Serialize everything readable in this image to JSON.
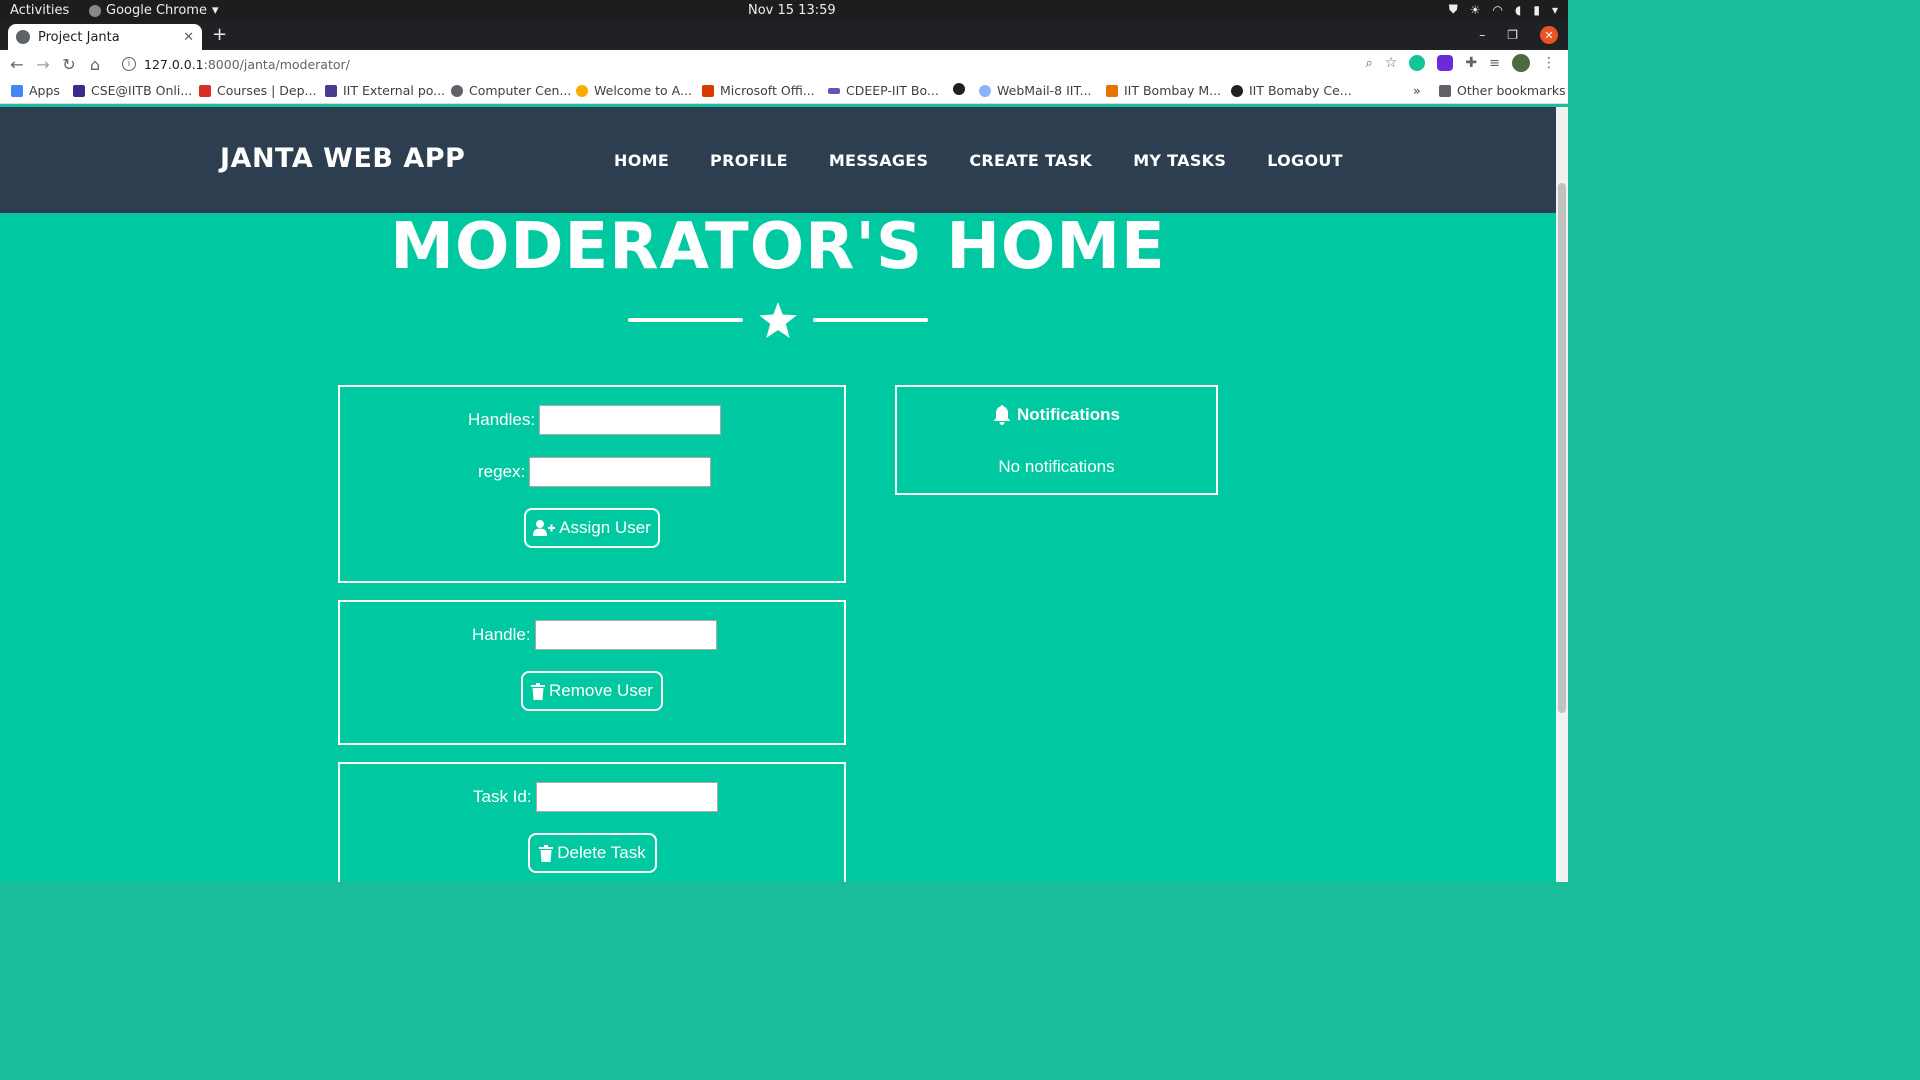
{
  "os": {
    "activities": "Activities",
    "app_name": "Google Chrome",
    "datetime": "Nov 15  13:59"
  },
  "browser": {
    "tab_title": "Project Janta",
    "url_host": "127.0.0.1",
    "url_path": ":8000/janta/moderator/",
    "bookmarks": [
      {
        "label": "Apps",
        "icon_color": "#4285f4"
      },
      {
        "label": "CSE@IITB Onli...",
        "icon_color": "#3f2a8c"
      },
      {
        "label": "Courses | Dep...",
        "icon_color": "#d93025"
      },
      {
        "label": "IIT External po...",
        "icon_color": "#4b3b8f"
      },
      {
        "label": "Computer Cen...",
        "icon_color": "#5f6368"
      },
      {
        "label": "Welcome to A...",
        "icon_color": "#f9ab00"
      },
      {
        "label": "Microsoft Offi...",
        "icon_color": "#d83b01"
      },
      {
        "label": "CDEEP-IIT Bo...",
        "icon_color": "#6b4fbb"
      },
      {
        "label": "",
        "icon_color": "#202124"
      },
      {
        "label": "WebMail-8 IIT...",
        "icon_color": "#8ab4f8"
      },
      {
        "label": "IIT Bombay M...",
        "icon_color": "#e37400"
      },
      {
        "label": "IIT Bomaby Ce...",
        "icon_color": "#202124"
      }
    ],
    "more_bookmarks": "»",
    "other_bookmarks": "Other bookmarks"
  },
  "site": {
    "brand": "JANTA WEB APP",
    "nav": [
      "HOME",
      "PROFILE",
      "MESSAGES",
      "CREATE TASK",
      "MY TASKS",
      "LOGOUT"
    ],
    "heading": "MODERATOR'S HOME"
  },
  "assign_form": {
    "handles_label": "Handles:",
    "regex_label": "regex:",
    "button": "Assign User"
  },
  "remove_form": {
    "handle_label": "Handle:",
    "button": "Remove User"
  },
  "delete_form": {
    "task_label": "Task Id:",
    "button": "Delete Task"
  },
  "notifications": {
    "title": "Notifications",
    "empty": "No notifications"
  },
  "colors": {
    "page_bg": "#00c9a2",
    "navbar_bg": "#2c3e50"
  }
}
